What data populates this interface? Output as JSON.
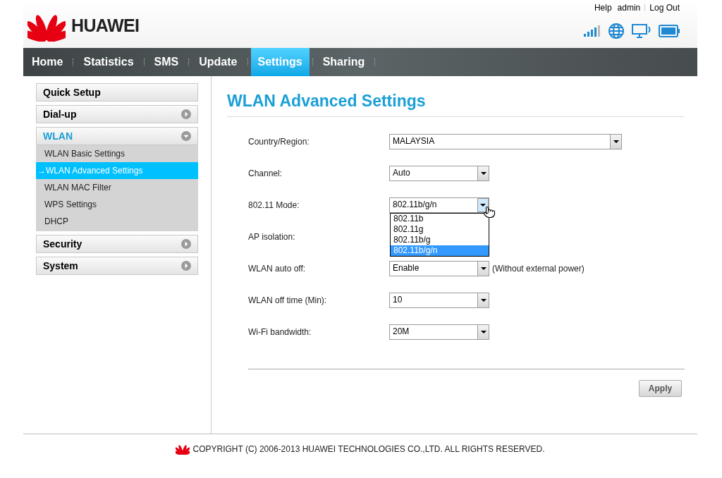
{
  "header": {
    "brand": "HUAWEI",
    "links": [
      "Help",
      "admin",
      "Log Out"
    ]
  },
  "nav": [
    {
      "label": "Home",
      "selected": false
    },
    {
      "label": "Statistics",
      "selected": false
    },
    {
      "label": "SMS",
      "selected": false
    },
    {
      "label": "Update",
      "selected": false
    },
    {
      "label": "Settings",
      "selected": true
    },
    {
      "label": "Sharing",
      "selected": false
    }
  ],
  "sidebar": [
    {
      "label": "Quick Setup",
      "kind": "link",
      "expanded": false
    },
    {
      "label": "Dial-up",
      "kind": "group",
      "expanded": false
    },
    {
      "label": "WLAN",
      "kind": "group",
      "expanded": true,
      "children": [
        {
          "label": "WLAN Basic Settings",
          "selected": false
        },
        {
          "label": "→WLAN Advanced Settings",
          "selected": true
        },
        {
          "label": "WLAN MAC Filter",
          "selected": false
        },
        {
          "label": "WPS Settings",
          "selected": false
        },
        {
          "label": "DHCP",
          "selected": false
        }
      ]
    },
    {
      "label": "Security",
      "kind": "group",
      "expanded": false
    },
    {
      "label": "System",
      "kind": "group",
      "expanded": false
    }
  ],
  "title": "WLAN Advanced Settings",
  "form": [
    {
      "label": "Country/Region:",
      "kind": "wide-select",
      "value": "MALAYSIA"
    },
    {
      "label": "Channel:",
      "kind": "select",
      "value": "Auto"
    },
    {
      "label": "802.11 Mode:",
      "kind": "select",
      "value": "802.11b/g/n",
      "open": true,
      "options": [
        {
          "label": "802.11b",
          "selected": false
        },
        {
          "label": "802.11g",
          "selected": false
        },
        {
          "label": "802.11b/g",
          "selected": false
        },
        {
          "label": "802.11b/g/n",
          "selected": true
        }
      ]
    },
    {
      "label": "AP isolation:",
      "kind": "covered"
    },
    {
      "label": "WLAN auto off:",
      "kind": "select",
      "value": "Enable",
      "note": "(Without external power)"
    },
    {
      "label": "WLAN off time (Min):",
      "kind": "select",
      "value": "10"
    },
    {
      "label": "Wi-Fi bandwidth:",
      "kind": "select",
      "value": "20M"
    }
  ],
  "apply": "Apply",
  "copyright": "COPYRIGHT (C) 2006-2013 HUAWEI TECHNOLOGIES CO.,LTD. ALL RIGHTS RESERVED."
}
